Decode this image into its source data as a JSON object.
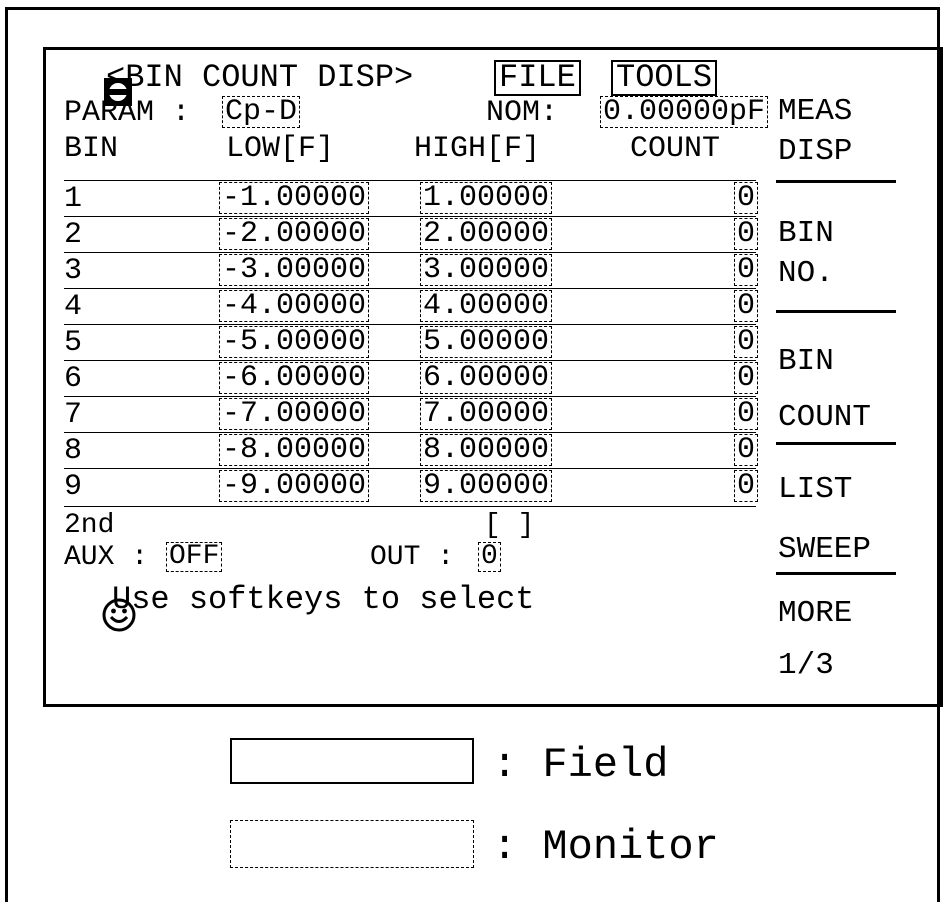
{
  "header": {
    "title": "<BIN COUNT DISP>",
    "file_label": "FILE",
    "tools_label": "TOOLS"
  },
  "param": {
    "label": "PARAM :",
    "value": "Cp-D",
    "nom_label": "NOM:",
    "nom_value": "0.00000pF"
  },
  "columns": [
    "BIN",
    "LOW[F]",
    "HIGH[F]",
    "COUNT"
  ],
  "rows": [
    {
      "bin": "1",
      "low": "-1.00000",
      "high": "1.00000",
      "count": "0"
    },
    {
      "bin": "2",
      "low": "-2.00000",
      "high": "2.00000",
      "count": "0"
    },
    {
      "bin": "3",
      "low": "-3.00000",
      "high": "3.00000",
      "count": "0"
    },
    {
      "bin": "4",
      "low": "-4.00000",
      "high": "4.00000",
      "count": "0"
    },
    {
      "bin": "5",
      "low": "-5.00000",
      "high": "5.00000",
      "count": "0"
    },
    {
      "bin": "6",
      "low": "-6.00000",
      "high": "6.00000",
      "count": "0"
    },
    {
      "bin": "7",
      "low": "-7.00000",
      "high": "7.00000",
      "count": "0"
    },
    {
      "bin": "8",
      "low": "-8.00000",
      "high": "8.00000",
      "count": "0"
    },
    {
      "bin": "9",
      "low": "-9.00000",
      "high": "9.00000",
      "count": "0"
    }
  ],
  "footer": {
    "second_label": "2nd",
    "second_value": "[ ]",
    "aux_label": "AUX :",
    "aux_value": "OFF",
    "out_label": "OUT :",
    "out_value": "0",
    "message": "Use softkeys to select"
  },
  "softkeys": [
    {
      "line1": "MEAS",
      "line2": "DISP"
    },
    {
      "line1": "BIN",
      "line2": "NO."
    },
    {
      "line1": "BIN",
      "line2": "COUNT"
    },
    {
      "line1": "LIST",
      "line2": "SWEEP"
    },
    {
      "line1": "MORE",
      "line2": "1/3"
    }
  ],
  "legend": {
    "field_label": ": Field",
    "monitor_label": ": Monitor"
  }
}
